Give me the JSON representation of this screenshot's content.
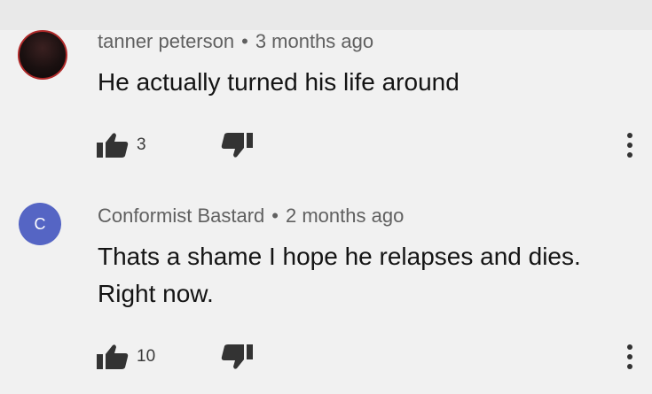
{
  "comments": [
    {
      "author": "tanner peterson",
      "separator": "•",
      "time": "3 months ago",
      "text": "He actually turned his life around",
      "likes": "3",
      "avatar_letter": ""
    },
    {
      "author": "Conformist Bastard",
      "separator": "•",
      "time": "2 months ago",
      "text_line1": "Thats a shame I hope he relapses and dies.",
      "text_line2": "Right now.",
      "likes": "10",
      "avatar_letter": "C"
    }
  ],
  "icons": {
    "like": "thumbs-up-icon",
    "dislike": "thumbs-down-icon",
    "more": "more-vertical-icon"
  },
  "colors": {
    "background": "#f1f1f1",
    "avatar_c": "#5565c4",
    "meta_text": "#606060",
    "body_text": "#141414"
  }
}
